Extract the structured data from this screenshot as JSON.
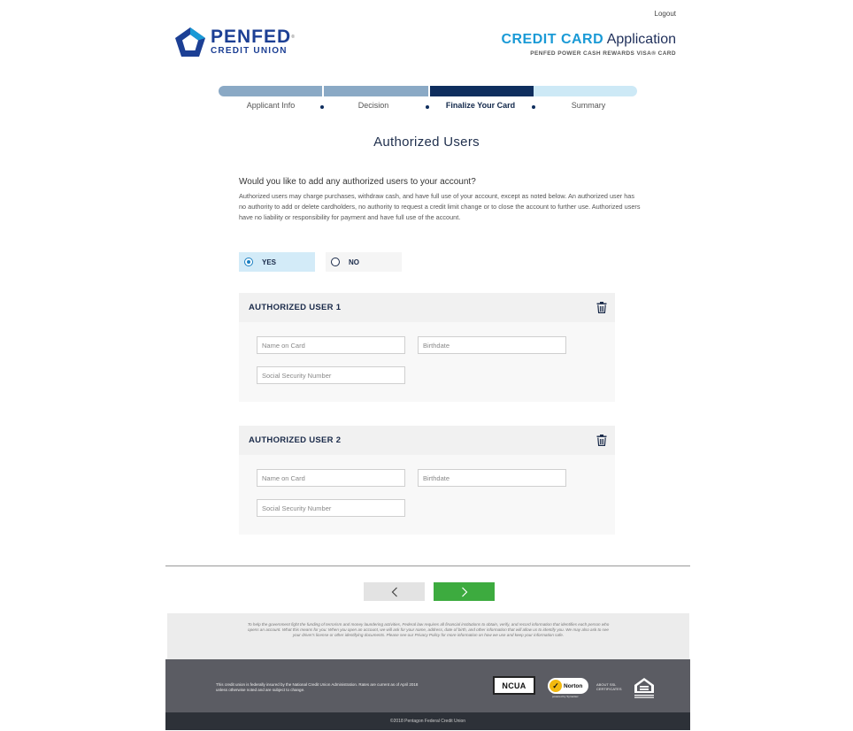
{
  "header": {
    "logout": "Logout",
    "logo_name": "PENFED",
    "logo_sub": "CREDIT UNION",
    "app_title_bold": "CREDIT CARD",
    "app_title_light": "Application",
    "app_subtitle": "PENFED POWER CASH REWARDS VISA® CARD"
  },
  "progress": {
    "steps": [
      {
        "label": "Applicant Info",
        "state": "done"
      },
      {
        "label": "Decision",
        "state": "done"
      },
      {
        "label": "Finalize Your Card",
        "state": "current"
      },
      {
        "label": "Summary",
        "state": "todo"
      }
    ]
  },
  "main": {
    "title": "Authorized Users",
    "question": "Would you like to add any authorized users to your account?",
    "disclaimer": "Authorized users may charge purchases, withdraw cash, and have full use of your account, except as noted below. An authorized user has no authority to add or delete cardholders, no authority to request a credit limit change or to close the account to further use. Authorized users have no liability or responsibility for payment and have full use of the account.",
    "radio": {
      "yes": "YES",
      "no": "NO",
      "selected": "yes"
    },
    "users": [
      {
        "title": "AUTHORIZED USER 1",
        "name_placeholder": "Name on Card",
        "birthdate_placeholder": "Birthdate",
        "ssn_placeholder": "Social Security Number"
      },
      {
        "title": "AUTHORIZED USER 2",
        "name_placeholder": "Name on Card",
        "birthdate_placeholder": "Birthdate",
        "ssn_placeholder": "Social Security Number"
      }
    ]
  },
  "legal": {
    "text": "To help the government fight the funding of terrorism and money laundering activities, Federal law requires all financial institutions to obtain, verify, and record information that identifies each person who opens an account. What this means for you: When you open an account, we will ask for your name, address, date of birth, and other information that will allow us to identify you. We may also ask to see your driver's license or other identifying documents. Please see our Privacy Policy for more information on how we use and keep your information safe."
  },
  "footer": {
    "note": "This credit union is federally insured by the National Credit Union Administration. Rates are current as of April 2018 unless otherwise noted and are subject to change.",
    "ncua": "NCUA",
    "norton": "Norton",
    "norton_sub": "powered by Symantec",
    "ssl": "ABOUT SSL\nCERTIFICATES",
    "copyright": "©2018 Pentagon Federal Credit Union"
  },
  "colors": {
    "brand_blue": "#1c3f94",
    "accent_cyan": "#1a9ad6",
    "progress_current": "#0f2e5e",
    "next_green": "#3dab3f"
  }
}
